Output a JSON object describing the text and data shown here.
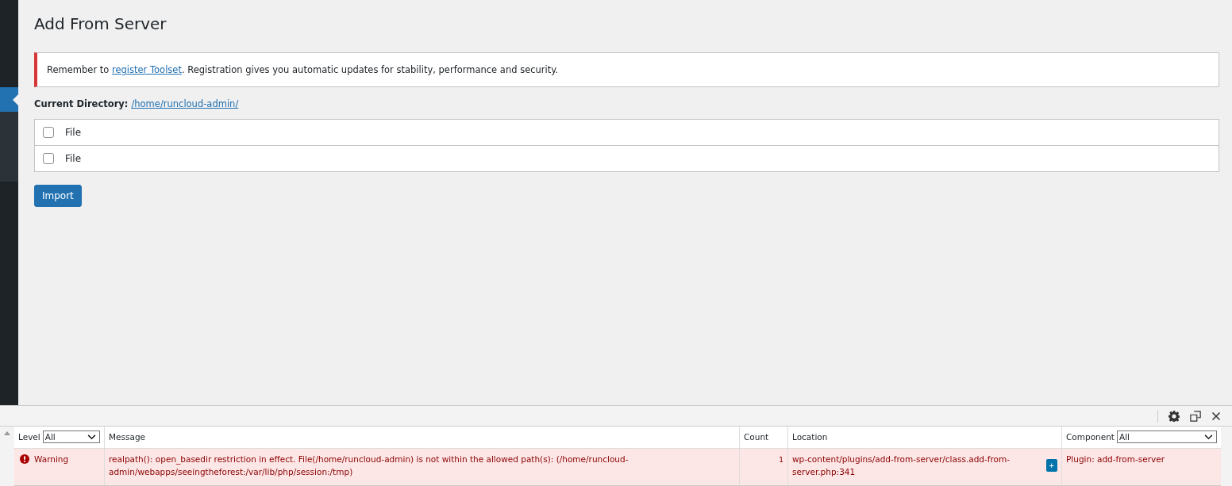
{
  "page": {
    "title": "Add From Server"
  },
  "notice": {
    "before": "Remember to ",
    "link": "register Toolset",
    "after": ". Registration gives you automatic updates for stability, performance and security."
  },
  "current_directory": {
    "label": "Current Directory:",
    "path": "/home/runcloud-admin/"
  },
  "files": [
    {
      "label": "File",
      "checked": false
    },
    {
      "label": "File",
      "checked": false
    }
  ],
  "import_button": "Import",
  "debug_panel": {
    "columns": [
      {
        "label": "Level",
        "filter": "All"
      },
      {
        "label": "Message"
      },
      {
        "label": "Count"
      },
      {
        "label": "Location"
      },
      {
        "label": "Component",
        "filter": "All"
      }
    ],
    "rows": [
      {
        "level": "Warning",
        "message": "realpath(): open_basedir restriction in effect. File(/home/runcloud-admin) is not within the allowed path(s): (/home/runcloud-admin/webapps/seeingtheforest:/var/lib/php/session:/tmp)",
        "count": "1",
        "location": "wp-content/plugins/add-from-server/class.add-from-server.php:341",
        "expand": "+",
        "component": "Plugin: add-from-server"
      }
    ]
  }
}
